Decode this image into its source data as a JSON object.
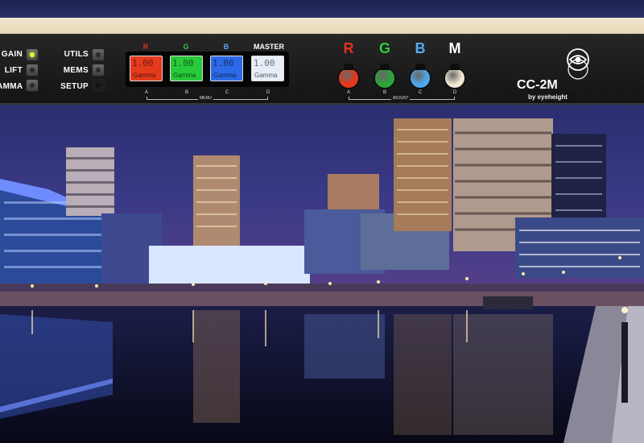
{
  "left_panel": {
    "gain_label": "GAIN",
    "lift_label": "LIFT",
    "gamma_label": "GAMMA",
    "utils_label": "UTILS",
    "mems_label": "MEMS",
    "setup_label": "SETUP"
  },
  "menu": {
    "headers": [
      "R",
      "G",
      "B",
      "MASTER"
    ],
    "screens": [
      {
        "value": "1.00",
        "name": "Gamma",
        "color": "#e53a1c"
      },
      {
        "value": "1.00",
        "name": "Gamma",
        "color": "#28c93a"
      },
      {
        "value": "1.00",
        "name": "Gamma",
        "color": "#2d6ae8"
      },
      {
        "value": "1.00",
        "name": "Gamma",
        "color": "#e8eef8"
      }
    ],
    "letters": [
      "A",
      "B",
      "C",
      "D"
    ],
    "group_label": "MENU"
  },
  "adjust": {
    "knobs": [
      {
        "label": "R",
        "label_color": "#e0321c",
        "color": "#e8371a"
      },
      {
        "label": "G",
        "label_color": "#2ecc40",
        "color": "#2aa63a"
      },
      {
        "label": "B",
        "label_color": "#55aaf5",
        "color": "#4ea8ec"
      },
      {
        "label": "M",
        "label_color": "#ffffff",
        "color": "#f1e7d2"
      }
    ],
    "letters": [
      "A",
      "B",
      "C",
      "D"
    ],
    "group_label": "ADJUST"
  },
  "brand": {
    "model": "CC-2M",
    "maker": "by eyeheight"
  }
}
